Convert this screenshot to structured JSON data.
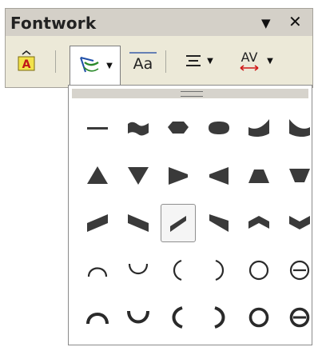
{
  "window": {
    "title": "Fontwork",
    "menu_icon": "dropdown-triangle",
    "close_icon": "close-x"
  },
  "toolbar": {
    "items": [
      {
        "name": "fontwork-gallery",
        "icon": "fontwork-letter-a-icon"
      },
      {
        "name": "fontwork-shape",
        "icon": "fontwork-shape-icon",
        "has_dropdown": true,
        "active": true
      },
      {
        "name": "fontwork-same-letter-heights",
        "icon": "same-letter-heights-icon",
        "glyph": "Aa"
      },
      {
        "name": "fontwork-alignment",
        "icon": "align-center-icon",
        "has_dropdown": true
      },
      {
        "name": "fontwork-character-spacing",
        "icon": "character-spacing-icon",
        "glyph": "AV",
        "has_dropdown": true
      }
    ]
  },
  "shape_popup": {
    "rows": [
      [
        "plain-text",
        "wave",
        "inflate",
        "stop",
        "curve-down",
        "curve-up"
      ],
      [
        "triangle-up",
        "triangle-down",
        "fade-right",
        "fade-left",
        "fade-up",
        "fade-down"
      ],
      [
        "slant-up",
        "slant-down",
        "fade-up-right",
        "fade-up-left",
        "chevron-up",
        "chevron-down"
      ],
      [
        "arch-up-curve",
        "arch-down-curve",
        "arch-left-curve",
        "arch-right-curve",
        "circle-curve",
        "open-circle-curve"
      ],
      [
        "arch-up-pour",
        "arch-down-pour",
        "arch-left-pour",
        "arch-right-pour",
        "circle-pour",
        "open-circle-pour"
      ]
    ],
    "selected": "fade-up-right",
    "colors": {
      "shape": "#3a3a3a",
      "curve": "#2a2a2a"
    }
  }
}
